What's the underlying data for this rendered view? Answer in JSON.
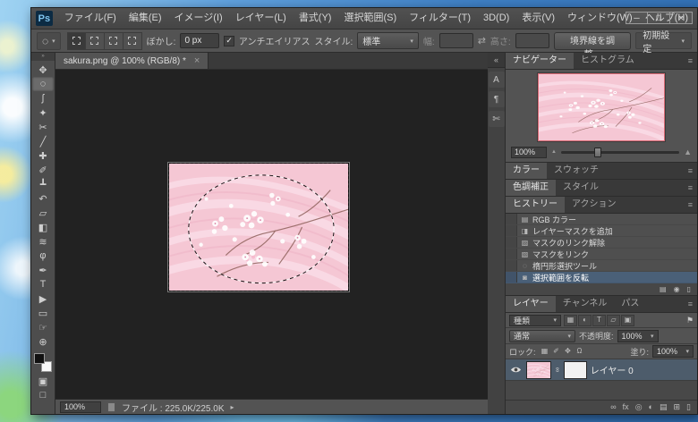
{
  "ui": {
    "arrow": "▾",
    "check": "✓",
    "panel_menu": "≡",
    "toolbar_grip": "»",
    "mountain": "▲",
    "chain": "∞",
    "quick_mask_glyph": "▣",
    "screen_mode_glyph": "□"
  },
  "colors": {
    "selection_highlight": "#4a6078",
    "canvas_background": "#222222",
    "image_base_pink": "#f5c7d4",
    "navigator_proxy_border": "#d96a75"
  },
  "titlebar": {
    "logo": "Ps",
    "menus": [
      "ファイル(F)",
      "編集(E)",
      "イメージ(I)",
      "レイヤー(L)",
      "書式(Y)",
      "選択範囲(S)",
      "フィルター(T)",
      "3D(D)",
      "表示(V)",
      "ウィンドウ(W)",
      "ヘルプ(H)"
    ],
    "controls": {
      "minimize": "─",
      "maximize": "□",
      "close": "×"
    }
  },
  "options": {
    "tool_icon": "◌",
    "feather_label": "ぼかし:",
    "feather_value": "0 px",
    "antialias_label": "アンチエイリアス",
    "style_label": "スタイル:",
    "style_value": "標準",
    "width_label": "幅:",
    "width_value": "",
    "swap_icon": "⇄",
    "height_label": "高さ:",
    "height_value": "",
    "refine_edge_label": "境界線を調整...",
    "workspace_label": "初期設定"
  },
  "tools": [
    {
      "name": "move-tool",
      "glyph": "✥"
    },
    {
      "name": "elliptical-marquee-tool",
      "glyph": "◌",
      "active": true
    },
    {
      "name": "lasso-tool",
      "glyph": "ʃ"
    },
    {
      "name": "quick-selection-tool",
      "glyph": "✦"
    },
    {
      "name": "crop-tool",
      "glyph": "✂"
    },
    {
      "name": "eyedropper-tool",
      "glyph": "╱"
    },
    {
      "name": "healing-brush-tool",
      "glyph": "✚"
    },
    {
      "name": "brush-tool",
      "glyph": "✐"
    },
    {
      "name": "clone-stamp-tool",
      "glyph": "┻"
    },
    {
      "name": "history-brush-tool",
      "glyph": "↶"
    },
    {
      "name": "eraser-tool",
      "glyph": "▱"
    },
    {
      "name": "gradient-tool",
      "glyph": "◧"
    },
    {
      "name": "blur-tool",
      "glyph": "≋"
    },
    {
      "name": "dodge-tool",
      "glyph": "φ"
    },
    {
      "name": "pen-tool",
      "glyph": "✒"
    },
    {
      "name": "type-tool",
      "glyph": "T"
    },
    {
      "name": "path-selection-tool",
      "glyph": "▶"
    },
    {
      "name": "rectangle-tool",
      "glyph": "▭"
    },
    {
      "name": "hand-tool",
      "glyph": "☞"
    },
    {
      "name": "zoom-tool",
      "glyph": "⊕"
    }
  ],
  "doc": {
    "tab_title": "sakura.png @ 100% (RGB/8) *",
    "close_glyph": "×"
  },
  "status": {
    "zoom": "100%",
    "info": "ファイル : 225.0K/225.0K",
    "arrow": "▸"
  },
  "dock_strip": {
    "expand_glyph": "«",
    "icons": [
      {
        "name": "character-panel-icon",
        "glyph": "A"
      },
      {
        "name": "paragraph-panel-icon",
        "glyph": "¶"
      },
      {
        "name": "clone-source-panel-icon",
        "glyph": "✄"
      }
    ]
  },
  "navigator": {
    "tabs": [
      "ナビゲーター",
      "ヒストグラム"
    ],
    "zoom_value": "100%"
  },
  "color_panel": {
    "tabs": [
      "カラー",
      "スウォッチ"
    ]
  },
  "adjustments_panel": {
    "tabs": [
      "色調補正",
      "スタイル"
    ]
  },
  "history": {
    "tabs": [
      "ヒストリー",
      "アクション"
    ],
    "items": [
      {
        "name": "history-state-rgb-color",
        "label": "RGB カラー",
        "icon": "▤"
      },
      {
        "name": "history-state-add-layer-mask",
        "label": "レイヤーマスクを追加",
        "icon": "◨"
      },
      {
        "name": "history-state-unlink-mask",
        "label": "マスクのリンク解除",
        "icon": "▨"
      },
      {
        "name": "history-state-link-mask",
        "label": "マスクをリンク",
        "icon": "▧"
      },
      {
        "name": "history-state-elliptical-marquee",
        "label": "楕円形選択ツール",
        "icon": "◌"
      },
      {
        "name": "history-state-inverse-selection",
        "label": "選択範囲を反転",
        "icon": "◙",
        "selected": true
      }
    ],
    "footer_icons": [
      {
        "name": "new-document-from-state-icon",
        "glyph": "▤"
      },
      {
        "name": "new-snapshot-icon",
        "glyph": "◉"
      },
      {
        "name": "delete-state-icon",
        "glyph": "▯"
      }
    ]
  },
  "layers": {
    "tabs": [
      "レイヤー",
      "チャンネル",
      "パス"
    ],
    "kind_label": "種類",
    "filter_icons": [
      {
        "name": "pixel-layer-filter-icon",
        "glyph": "▦"
      },
      {
        "name": "adjustment-layer-filter-icon",
        "glyph": "◐"
      },
      {
        "name": "type-layer-filter-icon",
        "glyph": "T"
      },
      {
        "name": "shape-layer-filter-icon",
        "glyph": "▱"
      },
      {
        "name": "smart-object-filter-icon",
        "glyph": "▣"
      }
    ],
    "filter_toggle": {
      "glyph": "⚑"
    },
    "blend_mode": "通常",
    "opacity_label": "不透明度:",
    "opacity_value": "100%",
    "lock_label": "ロック:",
    "lock_icons": [
      {
        "name": "lock-transparent-pixels-icon",
        "glyph": "▦"
      },
      {
        "name": "lock-image-pixels-icon",
        "glyph": "✐"
      },
      {
        "name": "lock-position-icon",
        "glyph": "✥"
      },
      {
        "name": "lock-all-icon",
        "glyph": "Ω"
      }
    ],
    "fill_label": "塗り:",
    "fill_value": "100%",
    "layer_name": "レイヤー 0",
    "footer_icons": [
      {
        "name": "link-layers-icon",
        "glyph": "∞"
      },
      {
        "name": "layer-effects-icon",
        "glyph": "fx"
      },
      {
        "name": "add-layer-mask-icon",
        "glyph": "◎"
      },
      {
        "name": "new-adjustment-layer-icon",
        "glyph": "◐"
      },
      {
        "name": "new-group-icon",
        "glyph": "▤"
      },
      {
        "name": "new-layer-icon",
        "glyph": "⊞"
      },
      {
        "name": "delete-layer-icon",
        "glyph": "▯"
      }
    ]
  }
}
